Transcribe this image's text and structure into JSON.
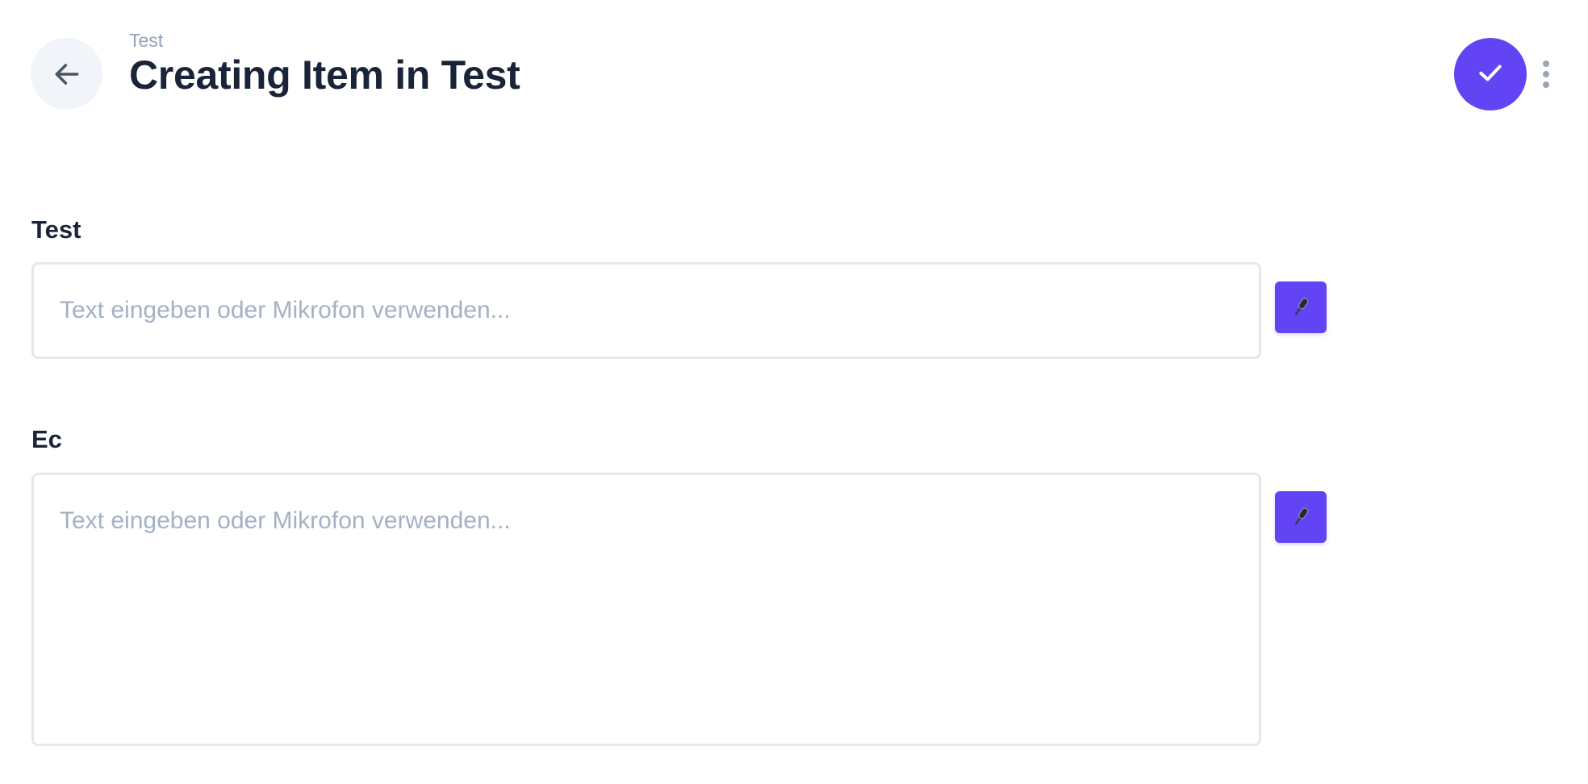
{
  "header": {
    "breadcrumb": "Test",
    "title": "Creating Item in Test",
    "back_icon": "arrow-left-icon",
    "save_icon": "check-icon",
    "more_icon": "more-vertical-icon"
  },
  "fields": [
    {
      "label": "Test",
      "placeholder": "Text eingeben oder Mikrofon verwenden...",
      "value": "",
      "type": "single-line",
      "mic_icon": "microphone-icon"
    },
    {
      "label": "Ec",
      "placeholder": "Text eingeben oder Mikrofon verwenden...",
      "value": "",
      "type": "multi-line",
      "mic_icon": "microphone-icon"
    }
  ],
  "colors": {
    "accent": "#6244f5",
    "title": "#1a2438",
    "muted": "#94a3b8",
    "border": "#e3e8ef",
    "back_button_bg": "#f1f4f8"
  }
}
